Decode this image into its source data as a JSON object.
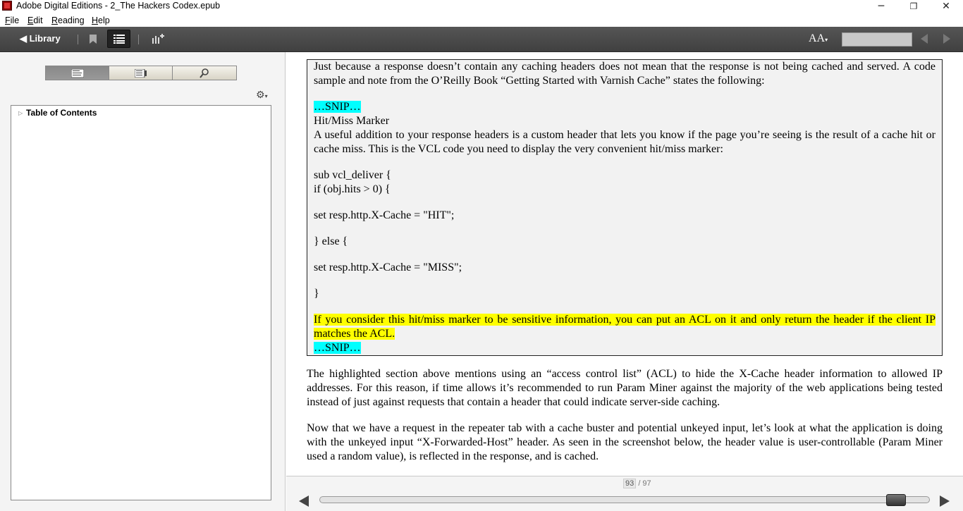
{
  "window": {
    "title": "Adobe Digital Editions - 2_The Hackers Codex.epub",
    "minimize": "─",
    "maximize": "❐",
    "close": "✕"
  },
  "menu": [
    {
      "first": "F",
      "rest": "ile"
    },
    {
      "first": "E",
      "rest": "dit"
    },
    {
      "first": "R",
      "rest": "eading"
    },
    {
      "first": "H",
      "rest": "elp"
    }
  ],
  "toolbar": {
    "library_label": "◀ Library",
    "bookmark_icon": "bookmark-icon",
    "toc_icon": "list-icon",
    "stats_icon": "chart-add-icon",
    "font_size_label": "AA",
    "page_field_value": ""
  },
  "sidebar": {
    "tabs": [
      "toc-tab",
      "bookmarks-tab",
      "search-tab"
    ],
    "toc_label": "Table of Contents"
  },
  "content": {
    "box": {
      "intro": "Just because a response doesn’t contain any caching headers does not mean that the response is not being cached and served. A code sample and note from the O’Reilly Book “Getting Started with Varnish Cache” states the following:",
      "snip_start": "…SNIP…",
      "heading": "Hit/Miss Marker",
      "desc": "A useful addition to your response headers is a custom header that lets you know if the page you’re seeing is the result of a cache hit or cache miss. This is the VCL code you need to display the very convenient hit/miss marker:",
      "code1": "sub vcl_deliver {",
      "code2": "if (obj.hits > 0) {",
      "code3": "set resp.http.X-Cache = \"HIT\";",
      "code4": "} else {",
      "code5": "set resp.http.X-Cache = \"MISS\";",
      "code6": "}",
      "note": "If you consider this hit/miss marker to be sensitive information, you can put an ACL on it and only return the header if the client IP matches the ACL.",
      "snip_end": "…SNIP…"
    },
    "para1": "The highlighted section above mentions using an “access control list” (ACL) to hide the X-Cache header information to allowed IP addresses. For this reason, if time allows it’s recommended to run Param Miner against the majority of the web applications being tested instead of just against requests that contain a header that could indicate server-side caching.",
    "para2": "Now that we have a request in the repeater tab with a cache buster and potential unkeyed input, let’s look at what the application is doing with the unkeyed input “X-Forwarded-Host” header. As seen in the screenshot below, the header value is user-controllable (Param Miner used a random value), is reflected in the response, and is cached."
  },
  "footer": {
    "current_page": "93",
    "total_pages": "/ 97",
    "progress": 0.96
  },
  "colors": {
    "highlight_cyan": "#00ffff",
    "highlight_yellow": "#ffff00",
    "toolbar_bg": "#4a4a4a"
  }
}
